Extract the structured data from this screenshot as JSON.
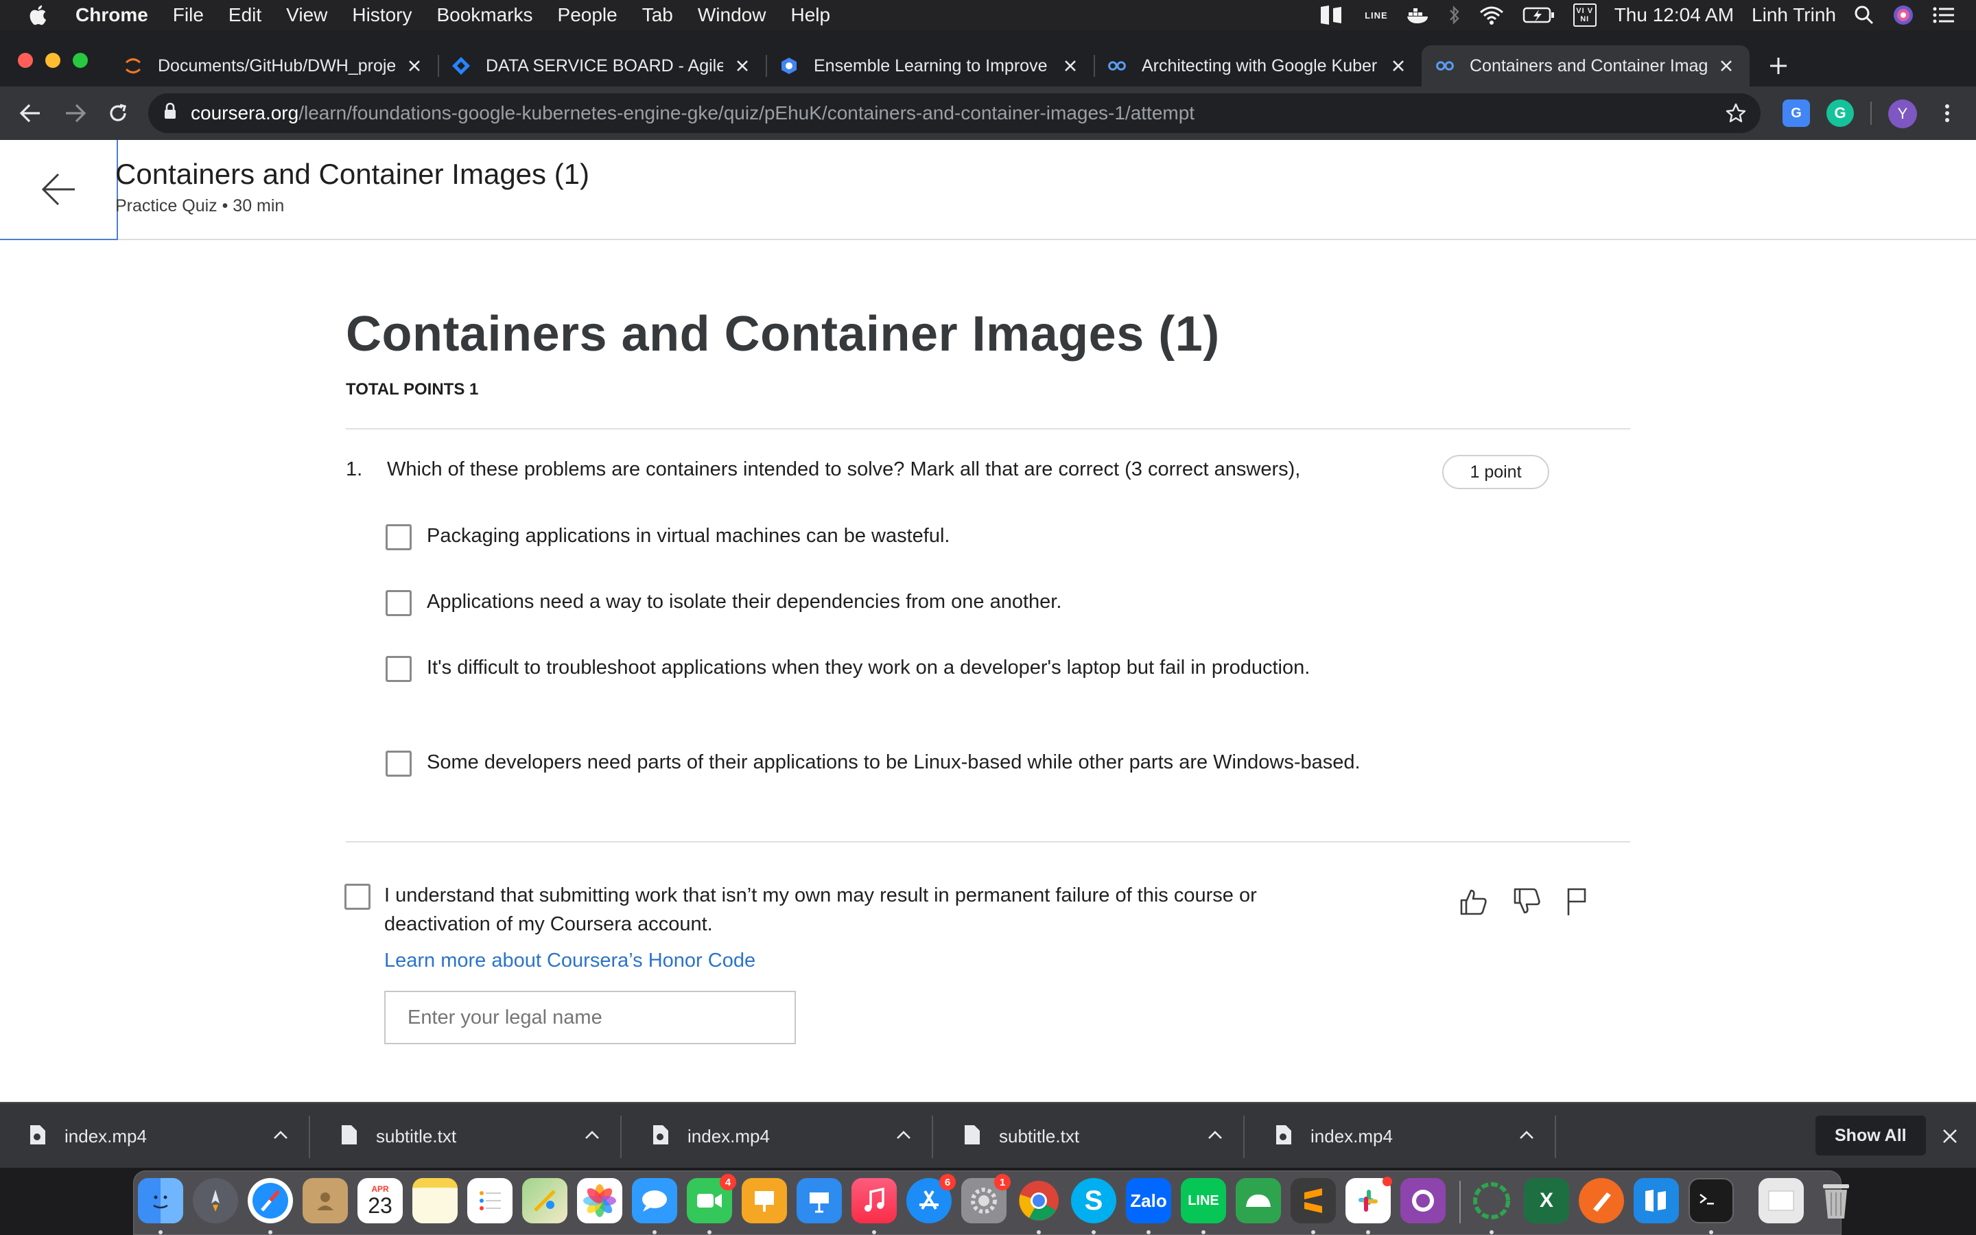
{
  "menubar": {
    "app_name": "Chrome",
    "items": [
      "File",
      "Edit",
      "View",
      "History",
      "Bookmarks",
      "People",
      "Tab",
      "Window",
      "Help"
    ],
    "clock": "Thu 12:04 AM",
    "user": "Linh Trinh",
    "status_icons": [
      "app-icon",
      "line-icon",
      "docker-icon",
      "bluetooth-icon",
      "wifi-icon",
      "battery-charging-icon",
      "input-source-icon",
      "spotlight-icon",
      "siri-icon",
      "notification-center-icon"
    ],
    "line_label": "LINE",
    "input_source_label": "VI VNI"
  },
  "tabs": [
    {
      "title": "Documents/GitHub/DWH_proje",
      "icon": "jupyter-icon"
    },
    {
      "title": "DATA SERVICE BOARD - Agile",
      "icon": "jira-icon"
    },
    {
      "title": "Ensemble Learning to Improve",
      "icon": "google-ml-icon"
    },
    {
      "title": "Architecting with Google Kuber",
      "icon": "coursera-icon"
    },
    {
      "title": "Containers and Container Imag",
      "icon": "coursera-icon",
      "active": true
    }
  ],
  "address_bar": {
    "host": "coursera.org",
    "path": "/learn/foundations-google-kubernetes-engine-gke/quiz/pEhuK/containers-and-container-images-1/attempt"
  },
  "profile_initial": "Y",
  "header": {
    "title": "Containers and Container Images (1)",
    "subtitle": "Practice Quiz • 30 min"
  },
  "quiz": {
    "title": "Containers and Container Images (1)",
    "total_points": "TOTAL POINTS 1",
    "question": {
      "number": "1.",
      "text": "Which of these problems are containers intended to solve? Mark all that are correct (3 correct answers),",
      "points": "1 point",
      "options": [
        {
          "label": "Packaging applications in virtual machines can be wasteful.",
          "checked": false
        },
        {
          "label": "Applications need a way to isolate their dependencies from one another.",
          "checked": false
        },
        {
          "label": "It's difficult to troubleshoot applications when they work on a developer's laptop but fail in production.",
          "checked": false
        },
        {
          "label": "Some developers need parts of their applications to be Linux-based while other parts are Windows-based.",
          "checked": false
        }
      ]
    },
    "honor": {
      "text": "I understand that submitting work that isn’t my own may result in permanent failure of this course or deactivation of my Coursera account.",
      "link": "Learn more about Coursera’s Honor Code",
      "input_placeholder": "Enter your legal name",
      "input_value": ""
    }
  },
  "downloads": {
    "items": [
      "index.mp4",
      "subtitle.txt",
      "index.mp4",
      "subtitle.txt",
      "index.mp4"
    ],
    "show_all": "Show All"
  },
  "dock": {
    "calendar_month": "APR",
    "calendar_day": "23",
    "facetime_badge": "4",
    "appstore_badge": "6",
    "prefs_badge": "1",
    "zalo_label": "Zalo",
    "line_label": "LINE",
    "excel_label": "X",
    "skype_label": "S"
  },
  "colors": {
    "link": "#2a73cc",
    "chrome_dark": "#35363a",
    "menubar": "#232325"
  }
}
